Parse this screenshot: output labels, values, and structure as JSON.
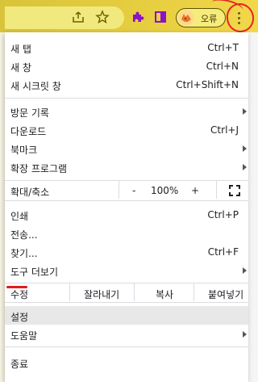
{
  "toolbar": {
    "profile_label": "오류",
    "icons": [
      "share-icon",
      "star-icon",
      "extensions-icon",
      "side-panel-icon",
      "kebab-menu-icon"
    ],
    "accent_color": "#e3cc3e",
    "annotation_color": "#e52525"
  },
  "menu": {
    "new_tab": {
      "label": "새 탭",
      "shortcut": "Ctrl+T"
    },
    "new_window": {
      "label": "새 창",
      "shortcut": "Ctrl+N"
    },
    "incognito": {
      "label": "새 시크릿 창",
      "shortcut": "Ctrl+Shift+N"
    },
    "history": {
      "label": "방문 기록"
    },
    "downloads": {
      "label": "다운로드",
      "shortcut": "Ctrl+J"
    },
    "bookmarks": {
      "label": "북마크"
    },
    "extensions": {
      "label": "확장 프로그램"
    },
    "zoom": {
      "label": "확대/축소",
      "minus": "-",
      "value": "100%",
      "plus": "+"
    },
    "print": {
      "label": "인쇄",
      "shortcut": "Ctrl+P"
    },
    "cast": {
      "label": "전송..."
    },
    "find": {
      "label": "찾기...",
      "shortcut": "Ctrl+F"
    },
    "more_tools": {
      "label": "도구 더보기"
    },
    "edit": {
      "label": "수정",
      "cut": "잘라내기",
      "copy": "복사",
      "paste": "붙여넣기"
    },
    "settings": {
      "label": "설정"
    },
    "help": {
      "label": "도움말"
    },
    "exit": {
      "label": "종료"
    }
  }
}
